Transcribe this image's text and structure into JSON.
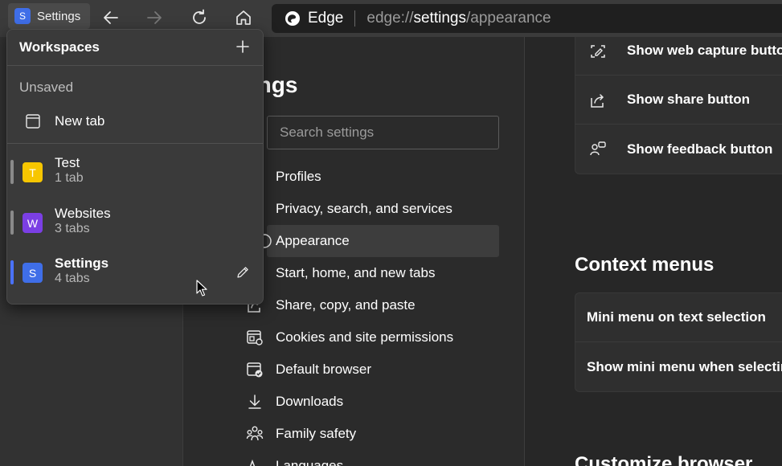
{
  "toolbar": {
    "workspace_chip": {
      "initial": "S",
      "label": "Settings"
    },
    "address": {
      "brand": "Edge",
      "url_prefix": "edge://",
      "url_highlight": "settings",
      "url_suffix": "/appearance"
    }
  },
  "settings_nav": {
    "title": "Settings",
    "search_placeholder": "Search settings",
    "items": [
      {
        "label": "Profiles",
        "icon": "profile-icon"
      },
      {
        "label": "Privacy, search, and services",
        "icon": "lock-icon"
      },
      {
        "label": "Appearance",
        "icon": "appearance-icon",
        "selected": true
      },
      {
        "label": "Start, home, and new tabs",
        "icon": "power-icon"
      },
      {
        "label": "Share, copy, and paste",
        "icon": "share-icon"
      },
      {
        "label": "Cookies and site permissions",
        "icon": "cookies-icon"
      },
      {
        "label": "Default browser",
        "icon": "default-browser-icon"
      },
      {
        "label": "Downloads",
        "icon": "download-icon"
      },
      {
        "label": "Family safety",
        "icon": "family-icon"
      },
      {
        "label": "Languages",
        "icon": "languages-icon"
      }
    ]
  },
  "content": {
    "toolbar_buttons": [
      {
        "label": "Show web capture button",
        "icon": "web-capture-icon"
      },
      {
        "label": "Show share button",
        "icon": "share-icon"
      },
      {
        "label": "Show feedback button",
        "icon": "feedback-icon"
      }
    ],
    "context_menus": {
      "title": "Context menus",
      "rows": [
        {
          "label": "Mini menu on text selection"
        },
        {
          "label": "Show mini menu when selecting text"
        }
      ]
    },
    "next_section_title": "Customize browser"
  },
  "workspaces_flyout": {
    "title": "Workspaces",
    "unsaved_label": "Unsaved",
    "new_tab_label": "New tab",
    "workspaces": [
      {
        "initial": "T",
        "name": "Test",
        "tabs": "1 tab",
        "color": "#f7c600",
        "bar_color": "#8a8a8a",
        "current": false
      },
      {
        "initial": "W",
        "name": "Websites",
        "tabs": "3 tabs",
        "color": "#7b3fe4",
        "bar_color": "#8a8a8a",
        "current": false
      },
      {
        "initial": "S",
        "name": "Settings",
        "tabs": "4 tabs",
        "color": "#3f6ee8",
        "bar_color": "#4a72ff",
        "current": true
      }
    ]
  }
}
